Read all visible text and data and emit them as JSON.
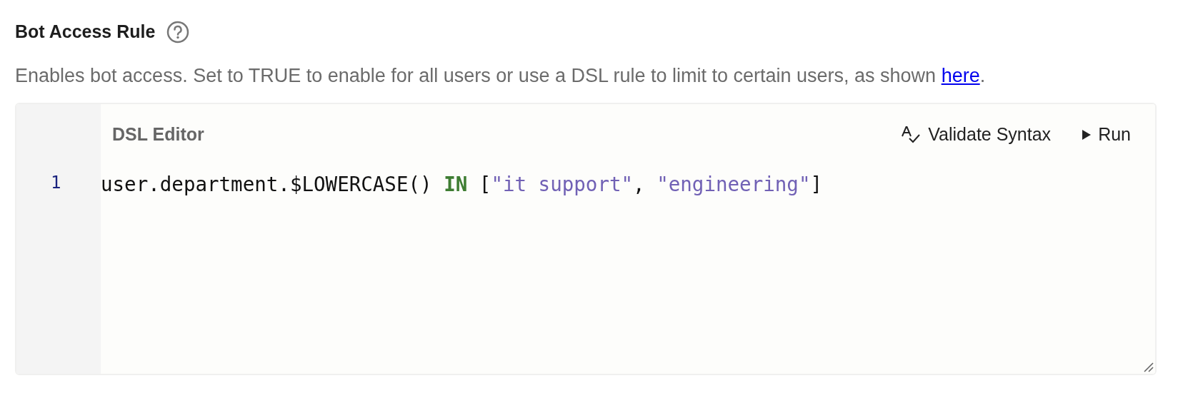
{
  "field": {
    "label": "Bot Access Rule"
  },
  "description": [
    {
      "kind": "text",
      "text": "Enables bot access. Set to TRUE to enable for all users or use a DSL rule to limit to certain users, as shown "
    },
    {
      "kind": "link",
      "text": "here"
    },
    {
      "kind": "text",
      "text": "."
    }
  ],
  "editor": {
    "title": "DSL Editor",
    "actions": [
      {
        "kind": "validate",
        "label": "Validate Syntax"
      },
      {
        "kind": "run",
        "label": "Run"
      }
    ],
    "lines": [
      {
        "number": "1",
        "tokens": [
          {
            "kind": "plain",
            "text": "user.department.$LOWERCASE() "
          },
          {
            "kind": "keyword",
            "text": "IN"
          },
          {
            "kind": "plain",
            "text": " ["
          },
          {
            "kind": "string",
            "text": "\"it support\""
          },
          {
            "kind": "plain",
            "text": ", "
          },
          {
            "kind": "string",
            "text": "\"engineering\""
          },
          {
            "kind": "plain",
            "text": "]"
          }
        ]
      }
    ]
  }
}
